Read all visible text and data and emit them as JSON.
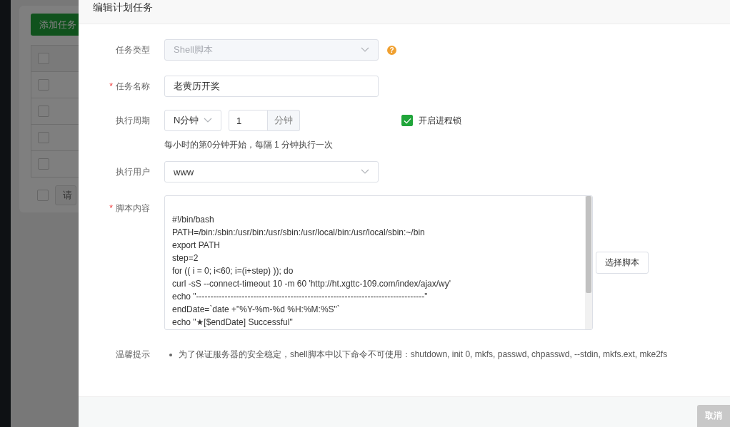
{
  "background_page": {
    "add_button": "添加任务",
    "table_rows": [
      {
        "checked": false
      },
      {
        "checked": false
      },
      {
        "checked": false
      },
      {
        "checked": false
      },
      {
        "checked": false
      }
    ],
    "bulk_select": {
      "checked": false,
      "button": "请"
    }
  },
  "dialog": {
    "title": "编辑计划任务",
    "task_type": {
      "label": "任务类型",
      "value": "Shell脚本",
      "disabled": true,
      "help": "?"
    },
    "task_name": {
      "label": "任务名称",
      "required_mark": "*",
      "value": "老黄历开奖"
    },
    "period": {
      "label": "执行周期",
      "unit_select": "N分钟",
      "amount": "1",
      "amount_unit": "分钟",
      "lock": {
        "label": "开启进程锁",
        "checked": true
      },
      "hint": "每小时的第0分钟开始，每隔 1 分钟执行一次"
    },
    "user": {
      "label": "执行用户",
      "value": "www",
      "disabled": false
    },
    "script": {
      "label": "脚本内容",
      "required_mark": "*",
      "choose_button": "选择脚本",
      "lines": [
        "#!/bin/bash",
        "PATH=/bin:/sbin:/usr/bin:/usr/sbin:/usr/local/bin:/usr/local/sbin:~/bin",
        "export PATH",
        "step=2",
        "for (( i = 0; i<60; i=(i+step) )); do",
        "curl -sS --connect-timeout 10 -m 60 'http://ht.xgttc-109.com/index/ajax/wy'",
        "echo \"--------------------------------------------------------------------------------\"",
        "endDate=`date +\"%Y-%m-%d %H:%M:%S\"`",
        "echo \"★[$endDate] Successful\""
      ]
    },
    "tip": {
      "label": "温馨提示",
      "items": [
        "为了保证服务器的安全稳定，shell脚本中以下命令不可使用：shutdown, init 0, mkfs, passwd, chpasswd, --stdin, mkfs.ext, mke2fs"
      ]
    },
    "footer": {
      "cancel_button": "取消"
    }
  }
}
